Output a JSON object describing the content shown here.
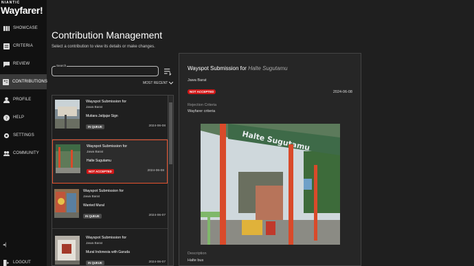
{
  "brand": {
    "top": "NIANTIC",
    "name": "Wayfarer!"
  },
  "nav": {
    "showcase": "SHOWCASE",
    "criteria": "CRITERIA",
    "review": "REVIEW",
    "contributions": "CONTRIBUTIONS",
    "profile": "PROFILE",
    "help": "HELP",
    "settings": "SETTINGS",
    "community": "COMMUNITY",
    "logout": "LOGOUT",
    "collapse_glyph": "◂|"
  },
  "header": {
    "title": "Contribution Management",
    "subtitle": "Select a contribution to view its details or make changes."
  },
  "search": {
    "label": "Search",
    "value": ""
  },
  "sort": {
    "label": "MOST RECENT"
  },
  "contributions": [
    {
      "title": "Wayspot Submission for",
      "region": "Jawa Barat",
      "name": "Mutiara Jatijajar Sign",
      "status": "IN QUEUE",
      "status_type": "queue",
      "date": "2024-06-08"
    },
    {
      "title": "Wayspot Submission for",
      "region": "Jawa Barat",
      "name": "Halte Sugutamu",
      "status": "NOT ACCEPTED",
      "status_type": "rejected",
      "date": "2024-06-08"
    },
    {
      "title": "Wayspot Submission for",
      "region": "Jawa Barat",
      "name": "Wanted Mural",
      "status": "IN QUEUE",
      "status_type": "queue",
      "date": "2024-06-07"
    },
    {
      "title": "Wayspot Submission for",
      "region": "Jawa Barat",
      "name": "Mural Indonesia with Garuda",
      "status": "IN QUEUE",
      "status_type": "queue",
      "date": "2024-06-07"
    }
  ],
  "detail": {
    "title_prefix": "Wayspot Submission for",
    "title_name": "Halte Sugutamu",
    "region": "Jawa Barat",
    "status": "NOT ACCEPTED",
    "date": "2024-06-08",
    "rejection_label": "Rejection Criteria",
    "rejection_value": "Wayfarer criteria",
    "photo_sign_text": "Halte Sugutamu",
    "description_label": "Description",
    "description_value": "Halte bus"
  },
  "colors": {
    "accent": "#e8532e",
    "rejected": "#d01818",
    "queue": "#4a4a4a",
    "background": "#1f1f1f",
    "sidebar": "#111111"
  }
}
